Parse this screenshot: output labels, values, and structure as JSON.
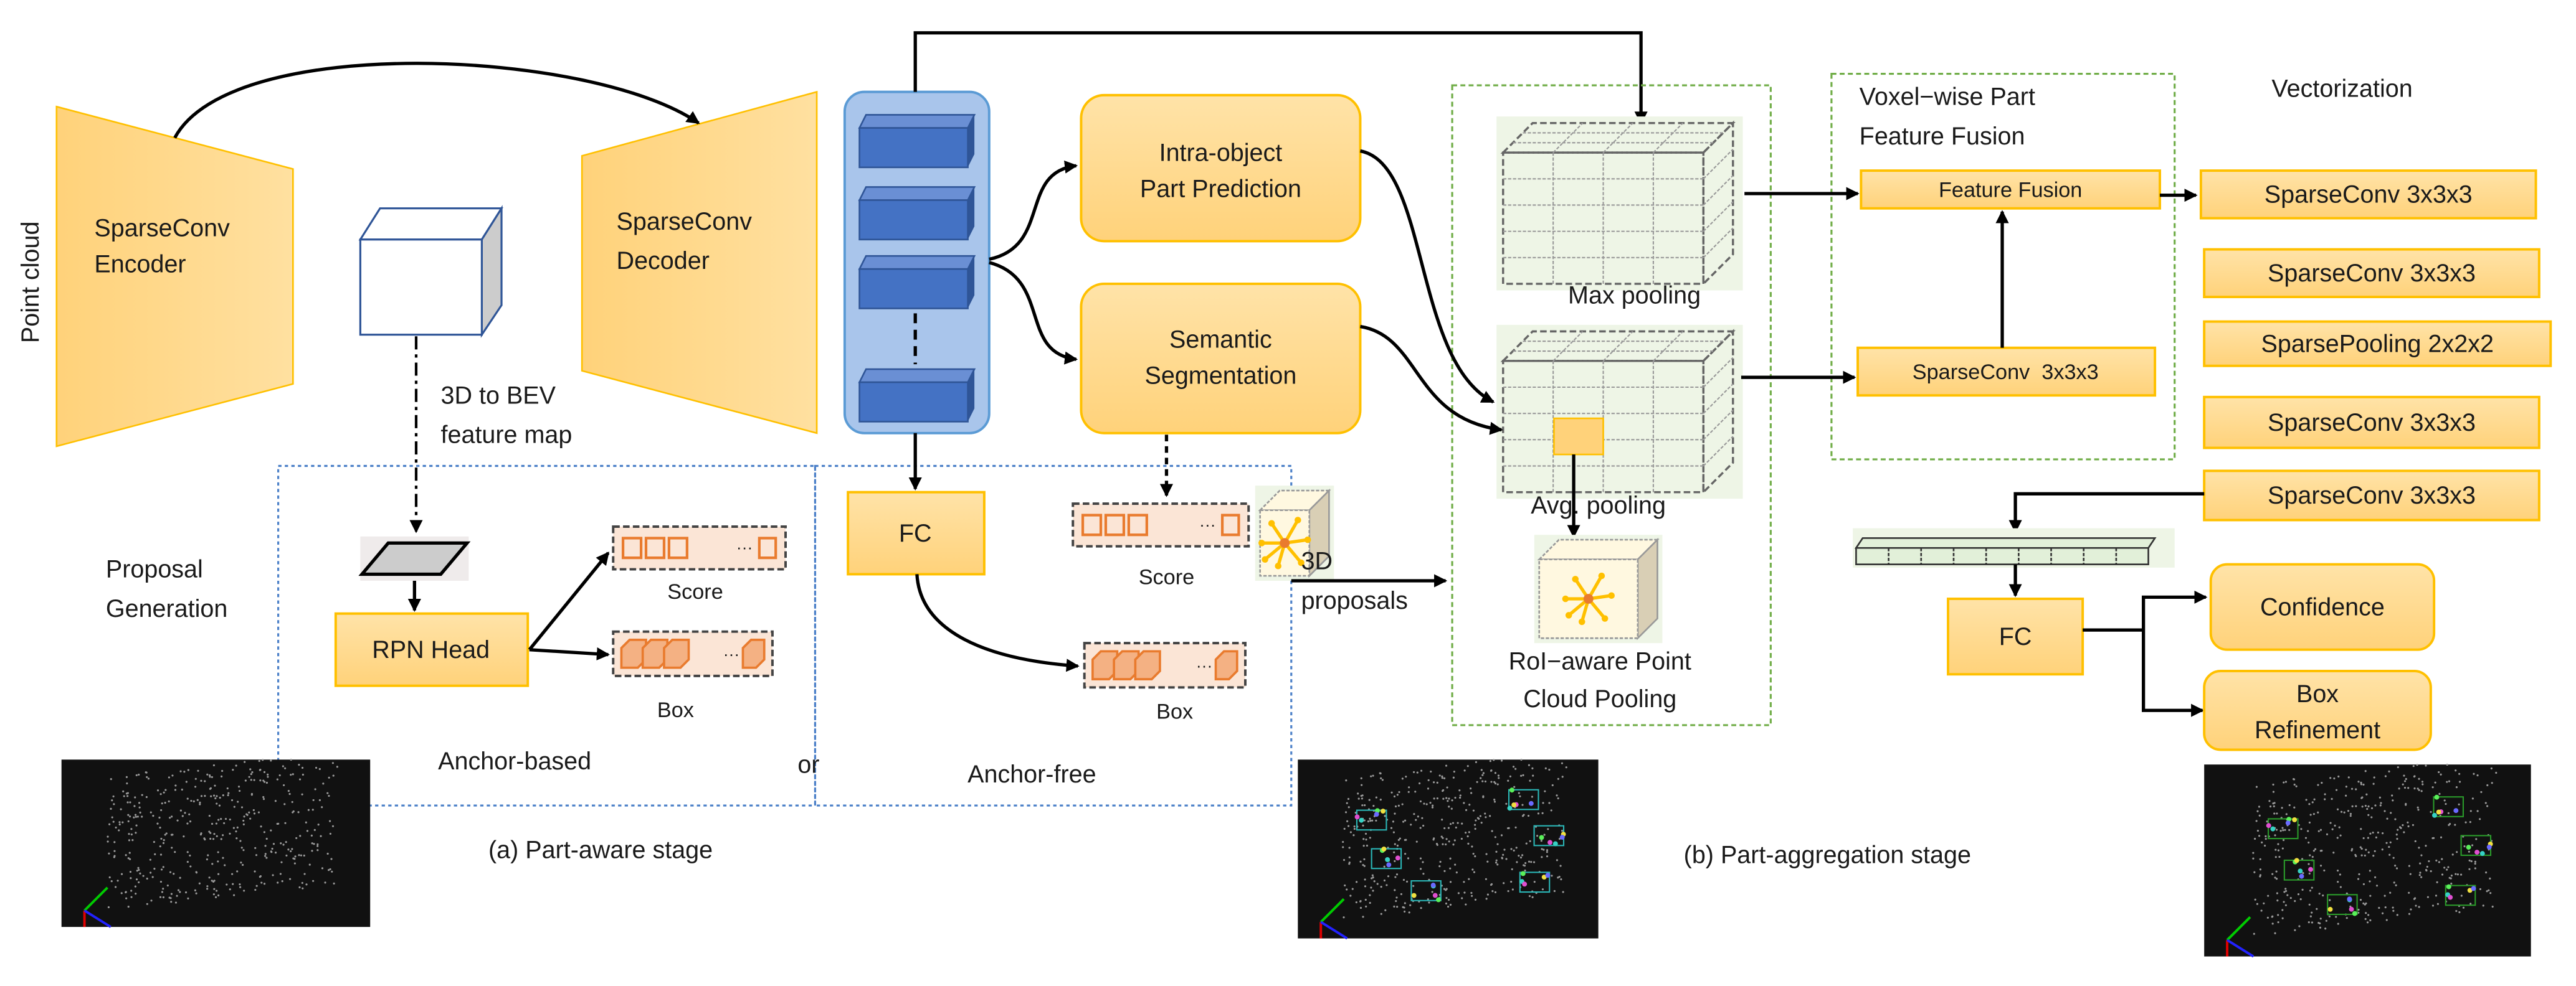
{
  "encoder": {
    "line1": "SparseConv",
    "line2": "Encoder"
  },
  "decoder": {
    "line1": "SparseConv",
    "line2": "Decoder"
  },
  "input_label": "Point cloud",
  "bev": {
    "line1": "3D to BEV",
    "line2": "feature map"
  },
  "proposal_generation": {
    "line1": "Proposal",
    "line2": "Generation"
  },
  "rpn_head": "RPN Head",
  "anchor_based": {
    "score": "Score",
    "box": "Box",
    "label": "Anchor-based"
  },
  "or_label": "or",
  "fc_label": "FC",
  "anchor_free": {
    "score": "Score",
    "box": "Box",
    "label": "Anchor-free"
  },
  "intra_object": {
    "line1": "Intra-object",
    "line2": "Part Prediction"
  },
  "semantic_seg": {
    "line1": "Semantic",
    "line2": "Segmentation"
  },
  "proposals": {
    "line1": "3D",
    "line2": "proposals"
  },
  "roi_pooling": {
    "max": "Max pooling",
    "avg": "Avg. pooling",
    "line1": "RoI−aware Point",
    "line2": "Cloud Pooling"
  },
  "voxel_fusion": {
    "line1": "Voxel−wise Part",
    "line2": "Feature Fusion",
    "feature_fusion": "Feature Fusion",
    "sparseconv": "SparseConv  3x3x3"
  },
  "vectorization": "Vectorization",
  "layers": [
    "SparseConv 3x3x3",
    "SparseConv 3x3x3",
    "SparsePooling 2x2x2",
    "SparseConv 3x3x3",
    "SparseConv 3x3x3"
  ],
  "head": {
    "fc": "FC",
    "confidence": "Confidence",
    "box_line1": "Box",
    "box_line2": "Refinement"
  },
  "captions": {
    "a": "(a) Part-aware stage",
    "b": "(b) Part-aggregation stage"
  },
  "colors": {
    "module_fill": "#FFD98A",
    "module_border": "#FFC000",
    "feature_block": "#4472C4",
    "feature_container": "#A9C5EB",
    "proposal_box": "#4A7FC8",
    "stage_box": "#70AD47",
    "output_cell": "#E97B2E"
  }
}
